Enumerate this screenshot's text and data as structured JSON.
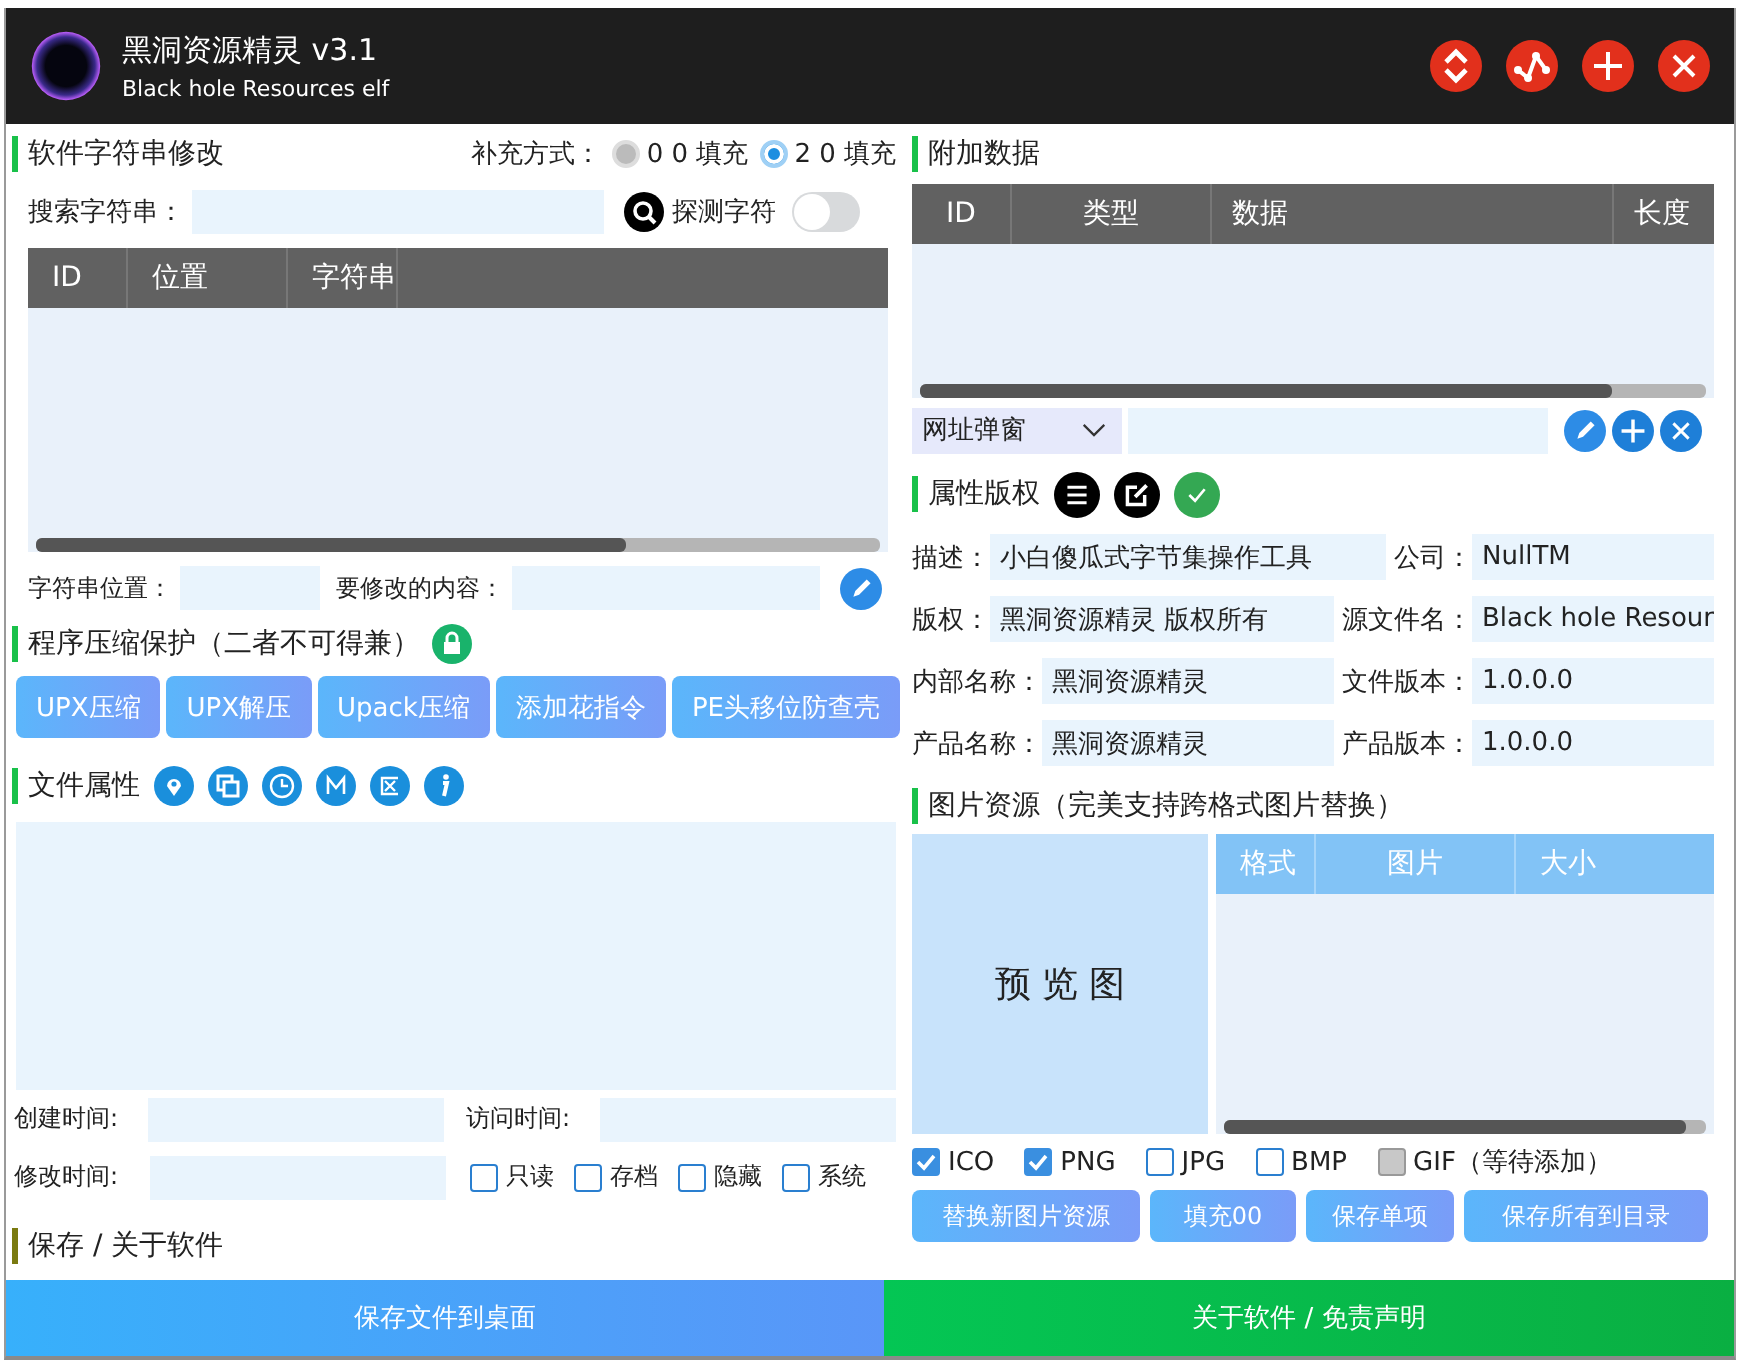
{
  "window": {
    "title": "黑洞资源精灵 v3.1",
    "subtitle": "Black hole Resources elf"
  },
  "strings": {
    "title": "软件字符串修改",
    "fill_label": "补充方式：",
    "fill_options": [
      {
        "label": "0 0 填充",
        "selected": false
      },
      {
        "label": "2 0 填充",
        "selected": true
      }
    ],
    "search_label": "搜索字符串：",
    "probe_label": "探测字符",
    "probe_on": false,
    "columns": [
      "ID",
      "位置",
      "字符串"
    ],
    "position_label": "字符串位置：",
    "content_label": "要修改的内容："
  },
  "compression": {
    "title": "程序压缩保护（二者不可得兼）",
    "buttons": [
      "UPX压缩",
      "UPX解压",
      "Upack压缩",
      "添加花指令",
      "PE头移位防查壳"
    ]
  },
  "file_attributes": {
    "title": "文件属性",
    "created_label": "创建时间:",
    "accessed_label": "访问时间:",
    "modified_label": "修改时间:",
    "flags": [
      {
        "label": "只读",
        "checked": false
      },
      {
        "label": "存档",
        "checked": false
      },
      {
        "label": "隐藏",
        "checked": false
      },
      {
        "label": "系统",
        "checked": false
      }
    ]
  },
  "save_title": "保存 / 关于软件",
  "extra_data": {
    "title": "附加数据",
    "columns": [
      "ID",
      "类型",
      "数据",
      "长度"
    ],
    "dropdown": "网址弹窗"
  },
  "version_info": {
    "title": "属性版权",
    "fields": [
      {
        "label": "描述：",
        "value": "小白傻瓜式字节集操作工具"
      },
      {
        "label": "公司：",
        "value": "NullTM"
      },
      {
        "label": "版权：",
        "value": "黑洞资源精灵 版权所有"
      },
      {
        "label": "源文件名：",
        "value": "Black hole Resour"
      },
      {
        "label": "内部名称：",
        "value": "黑洞资源精灵"
      },
      {
        "label": "文件版本：",
        "value": "1.0.0.0"
      },
      {
        "label": "产品名称：",
        "value": "黑洞资源精灵"
      },
      {
        "label": "产品版本：",
        "value": "1.0.0.0"
      }
    ]
  },
  "images": {
    "title": "图片资源（完美支持跨格式图片替换）",
    "preview": "预 览 图",
    "columns": [
      "格式",
      "图片",
      "大小"
    ],
    "formats": [
      {
        "label": "ICO",
        "checked": true,
        "disabled": false
      },
      {
        "label": "PNG",
        "checked": true,
        "disabled": false
      },
      {
        "label": "JPG",
        "checked": false,
        "disabled": false
      },
      {
        "label": "BMP",
        "checked": false,
        "disabled": false
      },
      {
        "label": "GIF（等待添加）",
        "checked": false,
        "disabled": true
      }
    ],
    "buttons": [
      "替换新图片资源",
      "填充00",
      "保存单项",
      "保存所有到目录"
    ]
  },
  "footer": [
    {
      "label": "保存文件到桌面",
      "kind": "blue"
    },
    {
      "label": "关于软件 / 免责声明",
      "kind": "green"
    }
  ]
}
